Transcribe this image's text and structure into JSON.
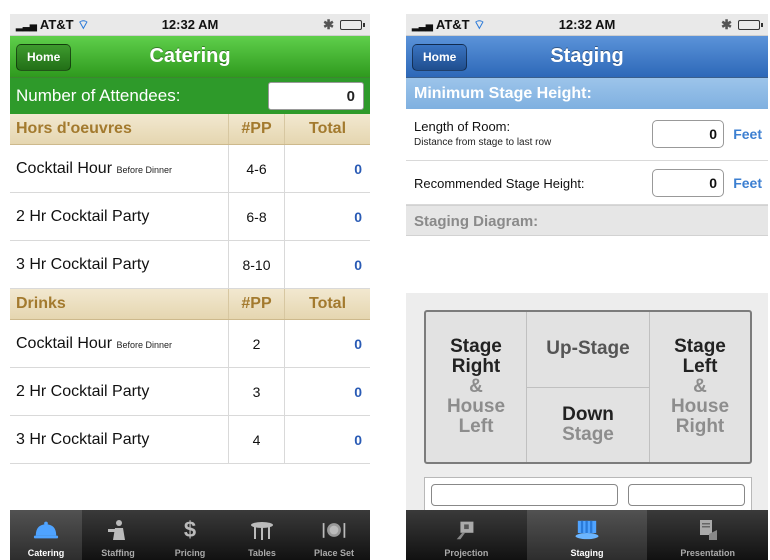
{
  "left": {
    "status": {
      "carrier": "AT&T",
      "time": "12:32 AM"
    },
    "nav": {
      "home": "Home",
      "title": "Catering"
    },
    "attendees": {
      "label": "Number of Attendees:",
      "value": "0"
    },
    "sections": [
      {
        "header": {
          "name": "Hors d'oeuvres",
          "pp": "#PP",
          "total": "Total"
        },
        "rows": [
          {
            "name": "Cocktail Hour",
            "note": "Before Dinner",
            "pp": "4-6",
            "total": "0"
          },
          {
            "name": "2 Hr Cocktail Party",
            "note": "",
            "pp": "6-8",
            "total": "0"
          },
          {
            "name": "3 Hr Cocktail Party",
            "note": "",
            "pp": "8-10",
            "total": "0"
          }
        ]
      },
      {
        "header": {
          "name": "Drinks",
          "pp": "#PP",
          "total": "Total"
        },
        "rows": [
          {
            "name": "Cocktail Hour",
            "note": "Before Dinner",
            "pp": "2",
            "total": "0"
          },
          {
            "name": "2 Hr Cocktail Party",
            "note": "",
            "pp": "3",
            "total": "0"
          },
          {
            "name": "3 Hr Cocktail Party",
            "note": "",
            "pp": "4",
            "total": "0"
          }
        ]
      }
    ],
    "tabs": [
      {
        "label": "Catering",
        "icon": "cloche-icon",
        "active": true
      },
      {
        "label": "Staffing",
        "icon": "staff-icon",
        "active": false
      },
      {
        "label": "Pricing",
        "icon": "dollar-icon",
        "active": false
      },
      {
        "label": "Tables",
        "icon": "table-icon",
        "active": false
      },
      {
        "label": "Place Set",
        "icon": "place-setting-icon",
        "active": false
      }
    ]
  },
  "right": {
    "status": {
      "carrier": "AT&T",
      "time": "12:32 AM"
    },
    "nav": {
      "home": "Home",
      "title": "Staging"
    },
    "min_stage_header": "Minimum Stage Height:",
    "length_room": {
      "label": "Length of Room:",
      "sub": "Distance from stage to last row",
      "value": "0",
      "unit": "Feet"
    },
    "recommended": {
      "label": "Recommended Stage Height:",
      "value": "0",
      "unit": "Feet"
    },
    "diagram_header": "Staging Diagram:",
    "diagram": {
      "left_top1": "Stage",
      "left_top2": "Right",
      "left_amp": "&",
      "left_bot1": "House",
      "left_bot2": "Left",
      "up_stage": "Up-Stage",
      "down1": "Down",
      "down2": "Stage",
      "right_top1": "Stage",
      "right_top2": "Left",
      "right_amp": "&",
      "right_bot1": "House",
      "right_bot2": "Right"
    },
    "tabs": [
      {
        "label": "Projection",
        "icon": "projector-icon",
        "active": false
      },
      {
        "label": "Staging",
        "icon": "stage-icon",
        "active": true
      },
      {
        "label": "Presentation",
        "icon": "presentation-icon",
        "active": false
      }
    ]
  },
  "colors": {
    "catering_green": "#2e9a2a",
    "staging_blue": "#2d68b8",
    "section_tan": "#e5d6b0",
    "total_blue": "#2a5bb5"
  }
}
